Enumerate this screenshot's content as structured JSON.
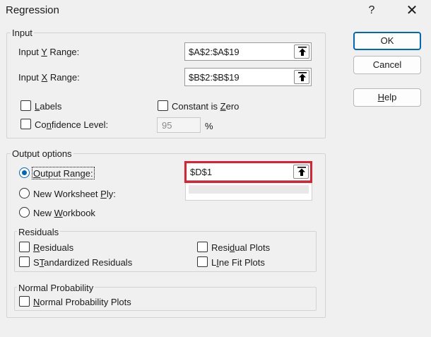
{
  "window": {
    "title": "Regression",
    "help_glyph": "?",
    "close_glyph": "✕"
  },
  "buttons": {
    "ok": "OK",
    "cancel": "Cancel",
    "help_prefix": "",
    "help_underline": "H",
    "help_rest": "elp"
  },
  "input": {
    "legend": "Input",
    "y_range": {
      "prefix": "Input ",
      "underline": "Y",
      "suffix": " Range:",
      "value": "$A$2:$A$19"
    },
    "x_range": {
      "prefix": "Input ",
      "underline": "X",
      "suffix": " Range:",
      "value": "$B$2:$B$19"
    },
    "labels": {
      "underline": "L",
      "rest": "abels",
      "checked": false
    },
    "constant_zero": {
      "prefix": "Constant is ",
      "underline": "Z",
      "rest": "ero",
      "checked": false
    },
    "confidence": {
      "prefix": "Co",
      "underline": "n",
      "rest": "fidence Level:",
      "checked": false,
      "value": "95",
      "unit": "%"
    }
  },
  "output": {
    "legend": "Output options",
    "output_range": {
      "underline": "O",
      "rest": "utput Range:",
      "selected": true,
      "value": "$D$1"
    },
    "new_worksheet": {
      "prefix": "New Worksheet ",
      "underline": "P",
      "rest": "ly:",
      "selected": false
    },
    "new_workbook": {
      "prefix": "New ",
      "underline": "W",
      "rest": "orkbook",
      "selected": false
    }
  },
  "residuals": {
    "legend": "Residuals",
    "residuals": {
      "underline": "R",
      "rest": "esiduals",
      "checked": false
    },
    "standardized": {
      "underline": "T",
      "prefix": "S",
      "rest": "andardized Residuals",
      "checked": false
    },
    "residual_plots": {
      "prefix": "Resi",
      "underline": "d",
      "rest": "ual Plots",
      "checked": false
    },
    "line_fit": {
      "underline": "I",
      "prefix": "L",
      "rest": "ne Fit Plots",
      "checked": false
    }
  },
  "normal_probability": {
    "legend": "Normal Probability",
    "plots": {
      "underline": "N",
      "rest": "ormal Probability Plots",
      "checked": false
    }
  },
  "colors": {
    "accent": "#0067c0",
    "highlight": "#e02030"
  }
}
